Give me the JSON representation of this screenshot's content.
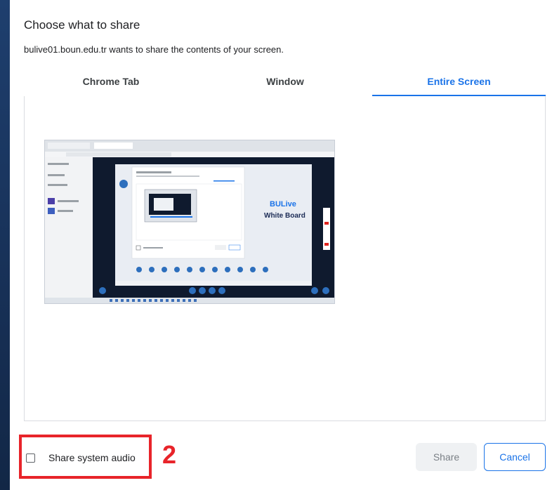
{
  "dialog": {
    "title": "Choose what to share",
    "subtitle": "bulive01.boun.edu.tr wants to share the contents of your screen."
  },
  "tabs": [
    {
      "label": "Chrome Tab",
      "active": false
    },
    {
      "label": "Window",
      "active": false
    },
    {
      "label": "Entire Screen",
      "active": true
    }
  ],
  "preview": {
    "brand": "BULive",
    "board_label": "White Board"
  },
  "footer": {
    "audio_label": "Share system audio",
    "audio_checked": false,
    "share_label": "Share",
    "cancel_label": "Cancel",
    "annotation_number": "2"
  },
  "colors": {
    "accent": "#1a73e8",
    "annotation": "#e8242a",
    "desktop": "#1d3b66"
  }
}
